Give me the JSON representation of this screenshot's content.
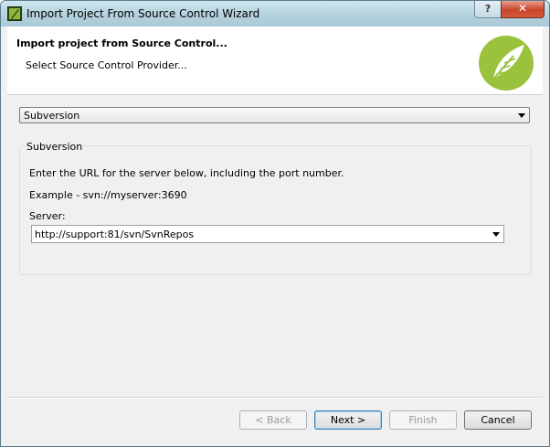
{
  "window": {
    "title": "Import Project From Source Control Wizard",
    "help_label": "?",
    "close_label": "✕"
  },
  "header": {
    "title": "Import project from Source Control...",
    "subtitle": "Select Source Control Provider..."
  },
  "provider": {
    "selected": "Subversion"
  },
  "group": {
    "legend": "Subversion",
    "instruction": "Enter the URL for the server below, including the port number.",
    "example": "Example - svn://myserver:3690",
    "server_label": "Server:",
    "server_value": "http://support:81/svn/SvnRepos"
  },
  "buttons": {
    "back": "< Back",
    "next": "Next >",
    "finish": "Finish",
    "cancel": "Cancel"
  },
  "colors": {
    "logo_green": "#9ac23c"
  },
  "icons": [
    "app-icon",
    "help-icon",
    "close-icon",
    "feather-logo-icon",
    "chevron-down-icon"
  ]
}
